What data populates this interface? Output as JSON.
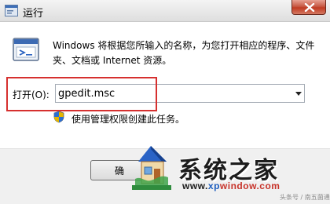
{
  "window": {
    "title": "运行",
    "icon": "run-icon",
    "close_icon": "close-icon"
  },
  "content": {
    "description": "Windows 将根据您所输入的名称，为您打开相应的程序、文件夹、文档或 Internet 资源。",
    "open_label": "打开(O):",
    "open_value": "gpedit.msc",
    "admin_note": "使用管理权限创建此任务。",
    "shield_icon": "shield-icon",
    "dropdown_icon": "dropdown-arrow-icon"
  },
  "buttons": {
    "ok_label": "确"
  },
  "watermark": {
    "title": "系统之家",
    "url_prefix": "www.",
    "url_mid": "xp",
    "url_suffix": "window.com",
    "credit": "头条号 / 南五菌通"
  },
  "colors": {
    "highlight": "#d6302f",
    "close_button": "#c13b22",
    "footer_bg": "#f0f0f0"
  }
}
